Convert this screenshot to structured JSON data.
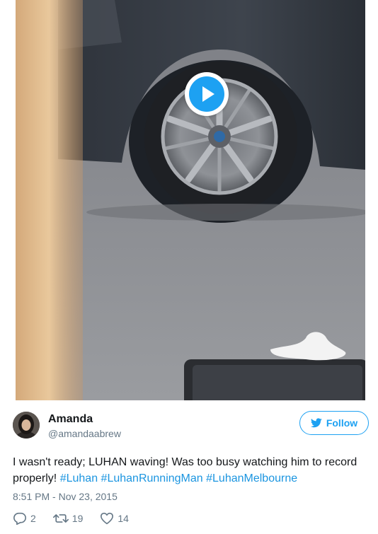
{
  "tweet": {
    "author_name": "Amanda",
    "author_handle": "@amandaabrew",
    "follow_label": "Follow",
    "text_parts": [
      "I wasn't ready; LUHAN waving! Was too busy watching him to record properly! ",
      "#Luhan",
      " ",
      "#LuhanRunningMan",
      " ",
      "#LuhanMelbourne"
    ],
    "timestamp": "8:51 PM - Nov 23, 2015",
    "replies": "2",
    "retweets": "19",
    "likes": "14"
  },
  "media": {
    "type": "video",
    "play_icon": "play-icon"
  },
  "colors": {
    "accent": "#1da1f2",
    "link": "#1b95e0",
    "muted": "#657786",
    "text": "#14171a"
  }
}
